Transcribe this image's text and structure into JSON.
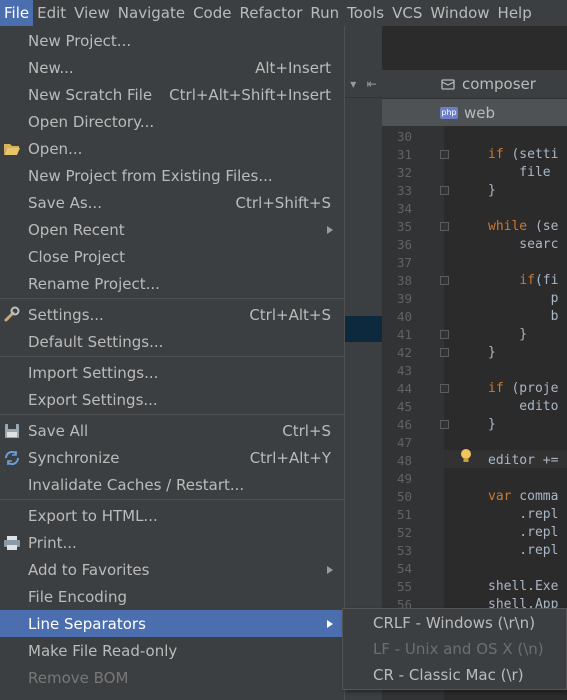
{
  "menubar": {
    "items": [
      "File",
      "Edit",
      "View",
      "Navigate",
      "Code",
      "Refactor",
      "Run",
      "Tools",
      "VCS",
      "Window",
      "Help"
    ]
  },
  "tabs": [
    {
      "label": "composer",
      "icon": "package-icon"
    },
    {
      "label": "web",
      "icon": "php-file-icon"
    }
  ],
  "editor": {
    "line_numbers": [
      "30",
      "31",
      "32",
      "33",
      "34",
      "35",
      "36",
      "37",
      "38",
      "39",
      "40",
      "41",
      "42",
      "43",
      "44",
      "45",
      "46",
      "47",
      "48",
      "49",
      "50",
      "51",
      "52",
      "53",
      "54",
      "55",
      "56"
    ],
    "lines": [
      "",
      "if (setti",
      "    file",
      "}",
      "",
      "while (se",
      "    searc",
      "",
      "    if(fi",
      "        p",
      "        b",
      "    }",
      "}",
      "",
      "if (proje",
      "    edito",
      "}",
      "",
      "editor +=",
      "",
      "var comma",
      "    .repl",
      "    .repl",
      "    .repl",
      "",
      "shell.Exe",
      "shell.App"
    ]
  },
  "file_menu": {
    "items": [
      {
        "label": "New Project...",
        "shortcut": "",
        "icon": "",
        "submenu": false
      },
      {
        "label": "New...",
        "shortcut": "Alt+Insert",
        "icon": "",
        "submenu": false
      },
      {
        "label": "New Scratch File",
        "shortcut": "Ctrl+Alt+Shift+Insert",
        "icon": "",
        "submenu": false
      },
      {
        "label": "Open Directory...",
        "shortcut": "",
        "icon": "",
        "submenu": false
      },
      {
        "label": "Open...",
        "shortcut": "",
        "icon": "folder-open-icon",
        "submenu": false
      },
      {
        "label": "New Project from Existing Files...",
        "shortcut": "",
        "icon": "",
        "submenu": false
      },
      {
        "label": "Save As...",
        "shortcut": "Ctrl+Shift+S",
        "icon": "",
        "submenu": false
      },
      {
        "label": "Open Recent",
        "shortcut": "",
        "icon": "",
        "submenu": true
      },
      {
        "label": "Close Project",
        "shortcut": "",
        "icon": "",
        "submenu": false
      },
      {
        "label": "Rename Project...",
        "shortcut": "",
        "icon": "",
        "submenu": false
      },
      {
        "label": "Settings...",
        "shortcut": "Ctrl+Alt+S",
        "icon": "wrench-icon",
        "submenu": false
      },
      {
        "label": "Default Settings...",
        "shortcut": "",
        "icon": "",
        "submenu": false
      },
      {
        "label": "Import Settings...",
        "shortcut": "",
        "icon": "",
        "submenu": false
      },
      {
        "label": "Export Settings...",
        "shortcut": "",
        "icon": "",
        "submenu": false
      },
      {
        "label": "Save All",
        "shortcut": "Ctrl+S",
        "icon": "save-all-icon",
        "submenu": false
      },
      {
        "label": "Synchronize",
        "shortcut": "Ctrl+Alt+Y",
        "icon": "sync-icon",
        "submenu": false
      },
      {
        "label": "Invalidate Caches / Restart...",
        "shortcut": "",
        "icon": "",
        "submenu": false
      },
      {
        "label": "Export to HTML...",
        "shortcut": "",
        "icon": "",
        "submenu": false
      },
      {
        "label": "Print...",
        "shortcut": "",
        "icon": "printer-icon",
        "submenu": false
      },
      {
        "label": "Add to Favorites",
        "shortcut": "",
        "icon": "",
        "submenu": true
      },
      {
        "label": "File Encoding",
        "shortcut": "",
        "icon": "",
        "submenu": false
      },
      {
        "label": "Line Separators",
        "shortcut": "",
        "icon": "",
        "submenu": true,
        "highlighted": true
      },
      {
        "label": "Make File Read-only",
        "shortcut": "",
        "icon": "",
        "submenu": false
      },
      {
        "label": "Remove BOM",
        "shortcut": "",
        "icon": "",
        "submenu": false,
        "disabled": true
      }
    ]
  },
  "line_separators_submenu": {
    "items": [
      {
        "label": "CRLF - Windows (\\r\\n)",
        "disabled": false
      },
      {
        "label": "LF - Unix and OS X (\\n)",
        "disabled": true
      },
      {
        "label": "CR - Classic Mac (\\r)",
        "disabled": false
      }
    ]
  },
  "colors": {
    "menu_bg": "#3c3f41",
    "highlight": "#4b6eaf",
    "editor_bg": "#2b2b2b",
    "keyword": "#cc7832",
    "text": "#bbbbbb"
  }
}
